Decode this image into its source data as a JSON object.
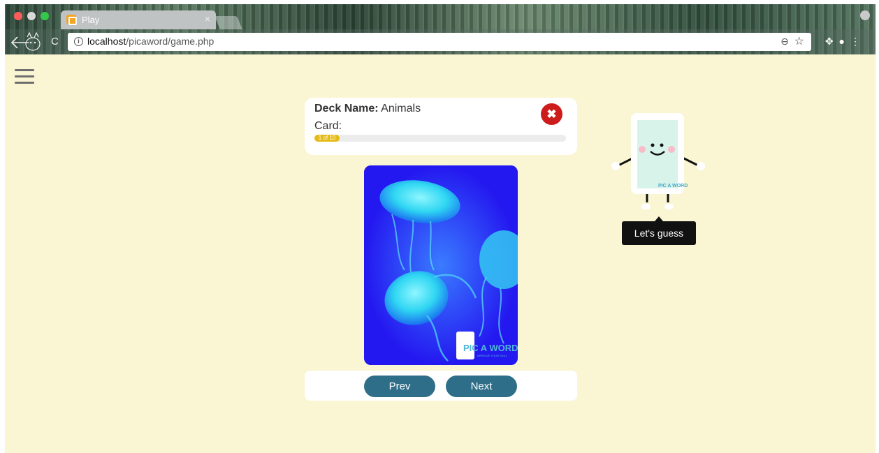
{
  "browser": {
    "tab_title": "Play",
    "tab_close": "×",
    "url_host": "localhost",
    "url_path": "/picaword/game.php"
  },
  "deck": {
    "name_label": "Deck Name:",
    "name_value": "Animals",
    "card_label": "Card:",
    "progress_text": "1 of 10",
    "current_card": 1,
    "total_cards": 10
  },
  "close_button": {
    "glyph": "✖"
  },
  "card_image": {
    "brand_text": "PIC A WORD",
    "brand_tagline": "IMPROVE YOUR SKILL",
    "background_color": "#2418f0",
    "subject": "jellyfish-icon"
  },
  "navigation": {
    "prev_label": "Prev",
    "next_label": "Next"
  },
  "mascot": {
    "brand_text": "PIC A WORD",
    "tooltip": "Let's guess"
  },
  "colors": {
    "page_background": "#faf5d2",
    "button": "#2f6e88",
    "close_button": "#cc1c1c",
    "progress": "#e5bb18"
  }
}
